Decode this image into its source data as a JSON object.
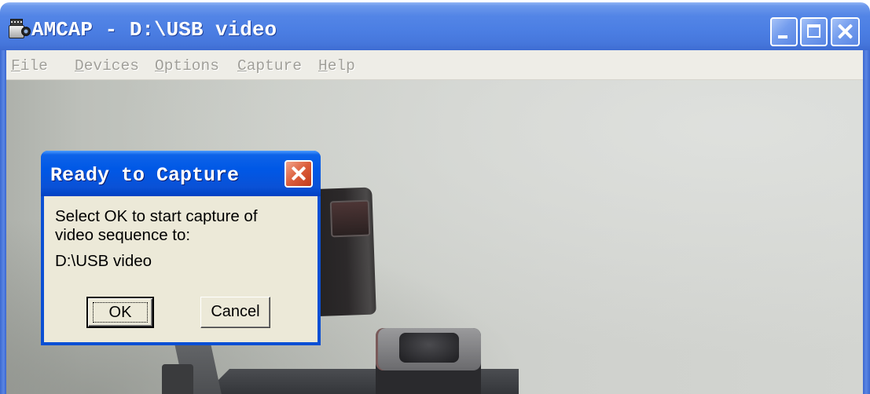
{
  "window": {
    "title": "AMCAP - D:\\USB video"
  },
  "menu": {
    "disabled": true,
    "items": [
      {
        "label": "File"
      },
      {
        "label": "Devices"
      },
      {
        "label": "Options"
      },
      {
        "label": "Capture"
      },
      {
        "label": "Help"
      }
    ]
  },
  "dialog": {
    "title": "Ready to Capture",
    "message_line1": "Select OK to start capture of",
    "message_line2": "video sequence to:",
    "file_path": "D:\\USB video",
    "ok_label": "OK",
    "cancel_label": "Cancel"
  },
  "icons": {
    "app": "amcap-app-icon",
    "minimize": "minimize-icon",
    "maximize": "maximize-icon",
    "close": "close-icon"
  },
  "colors": {
    "title_inactive": "#4b7ee3",
    "title_active": "#0058e6",
    "dialog_face": "#ece9d8",
    "close_red": "#db5d3a"
  }
}
